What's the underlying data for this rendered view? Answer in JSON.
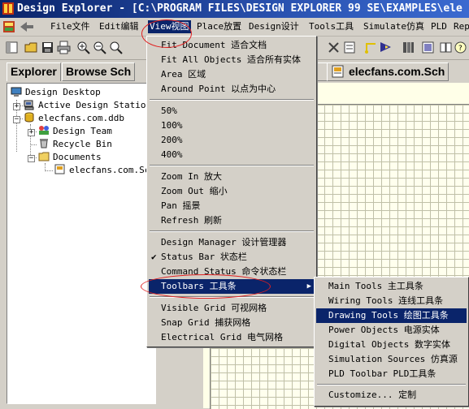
{
  "title": "Design Explorer - [C:\\PROGRAM FILES\\DESIGN EXPLORER 99 SE\\EXAMPLES\\ele",
  "menubar": [
    {
      "label": "File文件"
    },
    {
      "label": "Edit编辑"
    },
    {
      "label": "View视图"
    },
    {
      "label": "Place放置"
    },
    {
      "label": "Design设计"
    },
    {
      "label": "Tools工具"
    },
    {
      "label": "Simulate仿真"
    },
    {
      "label": "PLD"
    },
    {
      "label": "Rep"
    }
  ],
  "tabs": {
    "explorer": "Explorer",
    "browse": "Browse Sch",
    "doc_partial": "s",
    "doc": "elecfans.com.Sch"
  },
  "tree": {
    "desktop": "Design Desktop",
    "active_station": "Active Design Station",
    "db": "elecfans.com.ddb",
    "team": "Design Team",
    "recycle": "Recycle Bin",
    "documents": "Documents",
    "sch": "elecfans.com.Sc"
  },
  "view_menu": {
    "fit_document": "Fit Document 适合文档",
    "fit_all": "Fit All Objects 适合所有实体",
    "area": "Area 区域",
    "around_point": "Around Point 以点为中心",
    "z50": "50%",
    "z100": "100%",
    "z200": "200%",
    "z400": "400%",
    "zoom_in": "Zoom In 放大",
    "zoom_out": "Zoom Out 缩小",
    "pan": "Pan 摇景",
    "refresh": "Refresh 刷新",
    "design_manager": "Design Manager 设计管理器",
    "status_bar": "Status Bar 状态栏",
    "command_status": "Command Status 命令状态栏",
    "toolbars": "Toolbars 工具条",
    "visible_grid": "Visible Grid 可视网格",
    "snap_grid": "Snap Grid 捕获网格",
    "electrical_grid": "Electrical Grid 电气网格"
  },
  "toolbars_menu": {
    "main": "Main Tools 主工具条",
    "wiring": "Wiring Tools 连线工具条",
    "drawing": "Drawing Tools 绘图工具条",
    "power": "Power Objects 电源实体",
    "digital": "Digital Objects 数字实体",
    "simulation": "Simulation Sources 仿真源",
    "pld": "PLD Toolbar PLD工具条",
    "customize": "Customize... 定制"
  },
  "colors": {
    "highlight": "#0a246a",
    "annotation": "#e02020",
    "window_face": "#d4d0c8"
  }
}
